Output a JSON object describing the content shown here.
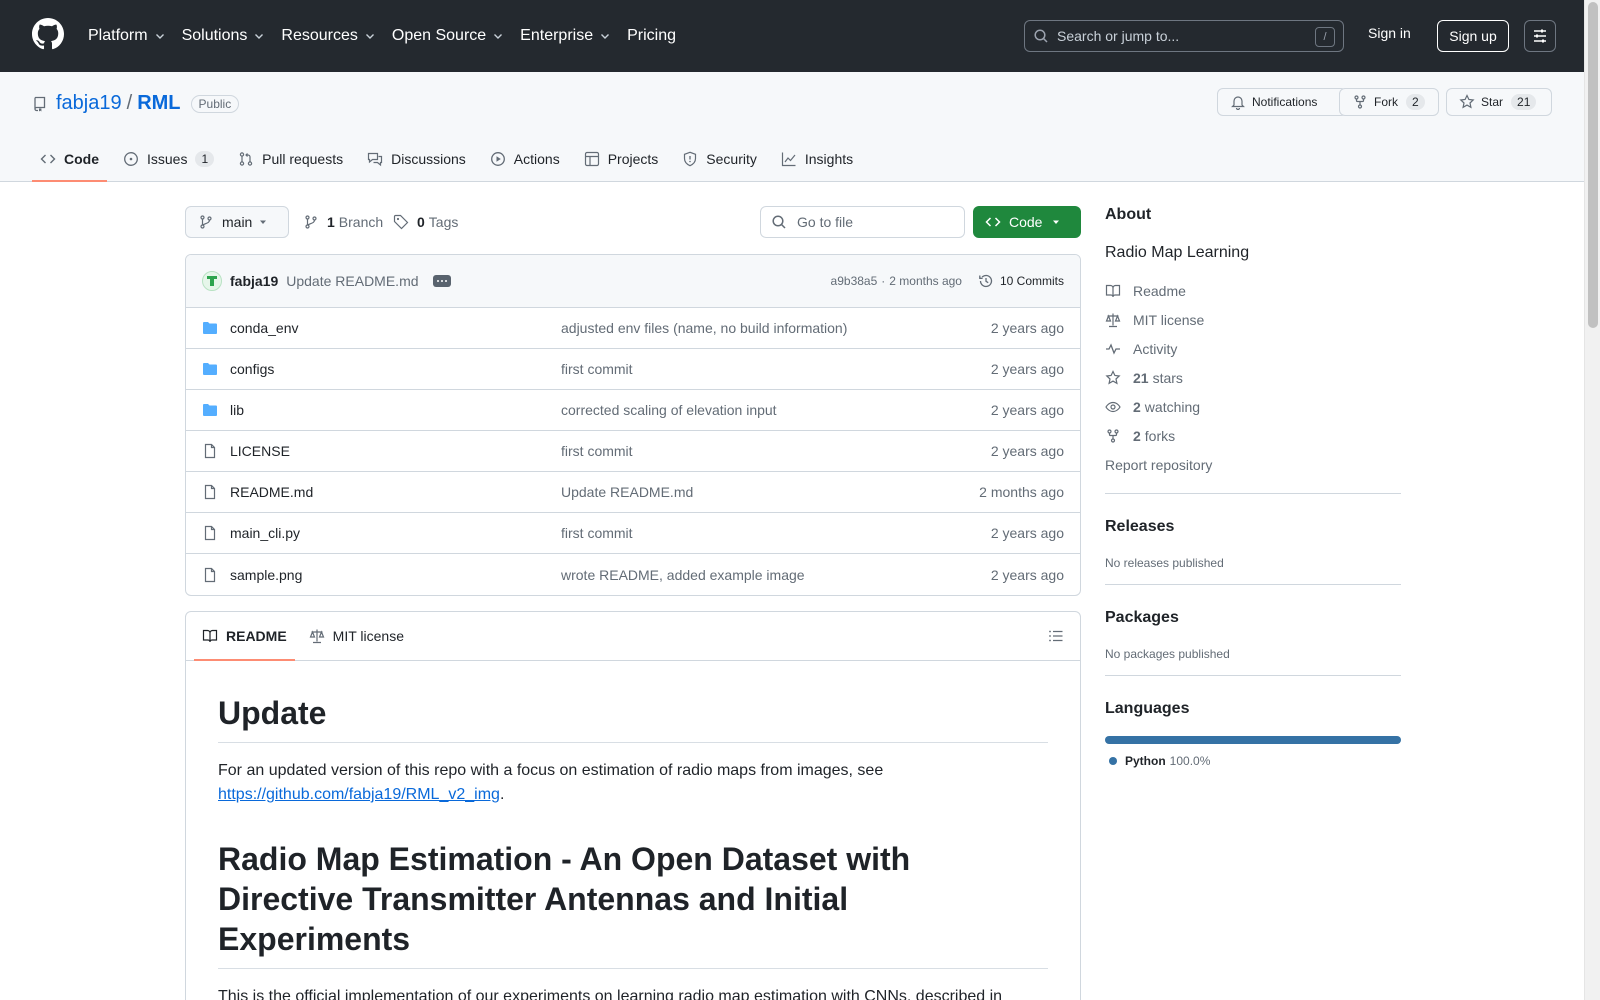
{
  "header": {
    "nav": [
      "Platform",
      "Solutions",
      "Resources",
      "Open Source",
      "Enterprise",
      "Pricing"
    ],
    "search_placeholder": "Search or jump to...",
    "search_key": "/",
    "signin": "Sign in",
    "signup": "Sign up"
  },
  "repo": {
    "owner": "fabja19",
    "separator": "/",
    "name": "RML",
    "visibility": "Public",
    "notifications": "Notifications",
    "fork_label": "Fork",
    "fork_count": "2",
    "star_label": "Star",
    "star_count": "21"
  },
  "tabs": [
    {
      "label": "Code",
      "icon": "code-icon"
    },
    {
      "label": "Issues",
      "icon": "issue-icon",
      "count": "1"
    },
    {
      "label": "Pull requests",
      "icon": "pull-request-icon"
    },
    {
      "label": "Discussions",
      "icon": "discussion-icon"
    },
    {
      "label": "Actions",
      "icon": "play-icon"
    },
    {
      "label": "Projects",
      "icon": "table-icon"
    },
    {
      "label": "Security",
      "icon": "shield-icon"
    },
    {
      "label": "Insights",
      "icon": "graph-icon"
    }
  ],
  "toolbar": {
    "branch": "main",
    "branch_count": "1",
    "branch_label": "Branch",
    "tag_count": "0",
    "tag_label": "Tags",
    "goto_placeholder": "Go to file",
    "code_label": "Code"
  },
  "commit": {
    "author": "fabja19",
    "message": "Update README.md",
    "hash": "a9b38a5",
    "dot": "·",
    "age": "2 months ago",
    "commits": "10 Commits"
  },
  "files": [
    {
      "type": "folder",
      "name": "conda_env",
      "message": "adjusted env files (name, no build information)",
      "date": "2 years ago"
    },
    {
      "type": "folder",
      "name": "configs",
      "message": "first commit",
      "date": "2 years ago"
    },
    {
      "type": "folder",
      "name": "lib",
      "message": "corrected scaling of elevation input",
      "date": "2 years ago"
    },
    {
      "type": "file",
      "name": "LICENSE",
      "message": "first commit",
      "date": "2 years ago"
    },
    {
      "type": "file",
      "name": "README.md",
      "message": "Update README.md",
      "date": "2 months ago"
    },
    {
      "type": "file",
      "name": "main_cli.py",
      "message": "first commit",
      "date": "2 years ago"
    },
    {
      "type": "file",
      "name": "sample.png",
      "message": "wrote README, added example image",
      "date": "2 years ago"
    }
  ],
  "readme": {
    "tab_readme": "README",
    "tab_license": "MIT license",
    "h1": "Update",
    "p1": "For an updated version of this repo with a focus on estimation of radio maps from images, see",
    "p1_link": "https://github.com/fabja19/RML_v2_img",
    "p1_end": ".",
    "h1b_line1": "Radio Map Estimation - An Open Dataset with",
    "h1b_line2": "Directive Transmitter Antennas and Initial",
    "h1b_line3": "Experiments",
    "p2": "This is the official implementation of our experiments on learning radio map estimation with CNNs, described in"
  },
  "sidebar": {
    "about_title": "About",
    "description": "Radio Map Learning",
    "readme": "Readme",
    "license": "MIT license",
    "activity": "Activity",
    "stars_count": "21",
    "stars_label": "stars",
    "watching_count": "2",
    "watching_label": "watching",
    "forks_count": "2",
    "forks_label": "forks",
    "report": "Report repository",
    "releases_title": "Releases",
    "releases_text": "No releases published",
    "packages_title": "Packages",
    "packages_text": "No packages published",
    "languages_title": "Languages",
    "language_name": "Python",
    "language_pct": "100.0%",
    "language_color": "#3572a5"
  },
  "colors": {
    "header_bg": "#24292f",
    "link": "#0969da",
    "code_button": "#1f883d",
    "tab_underline": "#fd8c73",
    "folder": "#54aeff"
  }
}
